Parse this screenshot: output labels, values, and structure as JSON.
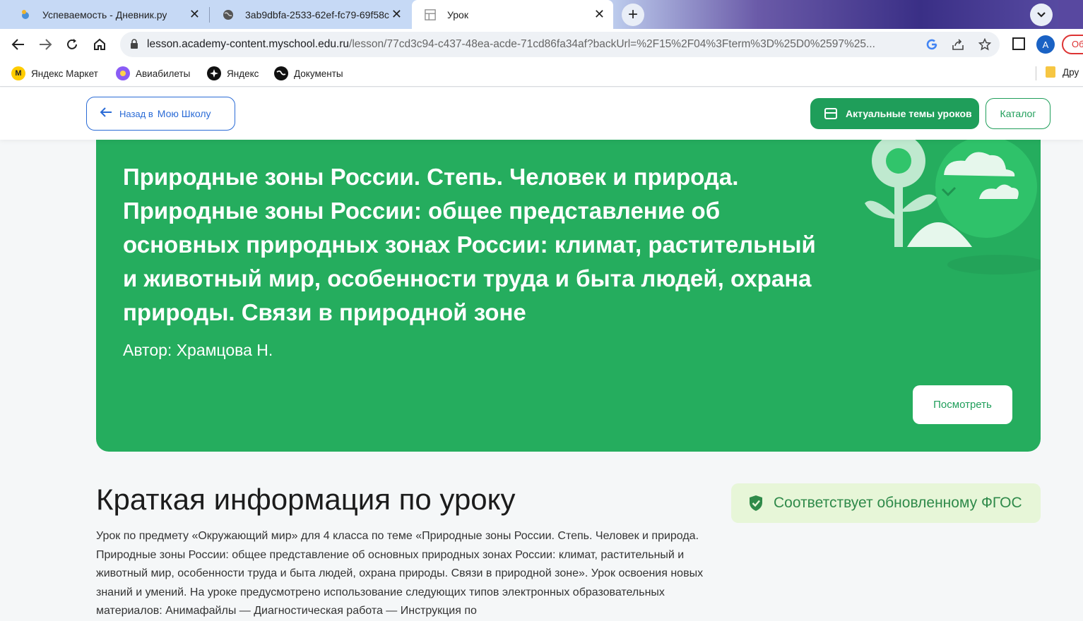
{
  "browser": {
    "tabs": [
      {
        "title": "Успеваемость - Дневник.ру",
        "icon": "dnevnik-icon",
        "active": false
      },
      {
        "title": "3ab9dbfa-2533-62ef-fc79-69f58c",
        "icon": "globe-icon",
        "active": false
      },
      {
        "title": "Урок",
        "icon": "page-grid-icon",
        "active": true
      }
    ],
    "new_tab_symbol": "+",
    "tab_close_symbol": "✕",
    "url_host": "lesson.academy-content.myschool.edu.ru",
    "url_path": "/lesson/77cd3c94-c437-48ea-acde-71cd86fa34af?backUrl=%2F15%2F04%3Fterm%3D%25D0%2597%25...",
    "avatar_letter": "A",
    "update_label": "Об"
  },
  "bookmarks": [
    {
      "label": "Яндекс Маркет",
      "icon": "yandex-market-icon",
      "color": "#ffcc00"
    },
    {
      "label": "Авиабилеты",
      "icon": "planet-icon",
      "color": "#8a5cf5"
    },
    {
      "label": "Яндекс",
      "icon": "yandex-icon",
      "color": "#111111"
    },
    {
      "label": "Документы",
      "icon": "globe-icon",
      "color": "#111111"
    }
  ],
  "bookmarks_other": "Дру",
  "header": {
    "back_prefix": "Назад в",
    "back_label": "Мою Школу",
    "topics_label": "Актуальные темы уроков",
    "catalog_label": "Каталог"
  },
  "hero": {
    "title": "Природные зоны России. Степь. Человек и природа. Природные зоны России: общее представление об основных природных зонах России: климат, растительный и животный мир, особенности труда и быта людей, охрана природы. Связи в природной зоне",
    "author": "Автор: Храмцова Н.",
    "watch_label": "Посмотреть"
  },
  "info": {
    "title": "Краткая информация по уроку",
    "fgos_label": "Соответствует обновленному ФГОС",
    "description": "Урок по предмету «Окружающий мир» для 4 класса по теме «Природные зоны России. Степь. Человек и природа. Природные зоны России: общее представление об основных природных зонах России: климат, растительный и животный мир, особенности труда и быта людей, охрана природы. Связи в природной зоне». Урок освоения новых знаний и умений. На уроке предусмотрено использование следующих типов электронных образовательных материалов: Анимафайлы — Диагностическая работа — Инструкция по"
  },
  "colors": {
    "brand_green": "#25ad5e",
    "button_green": "#1f9e5a",
    "link_blue": "#2a6bd6",
    "fgos_bg": "#e7f6d8"
  }
}
